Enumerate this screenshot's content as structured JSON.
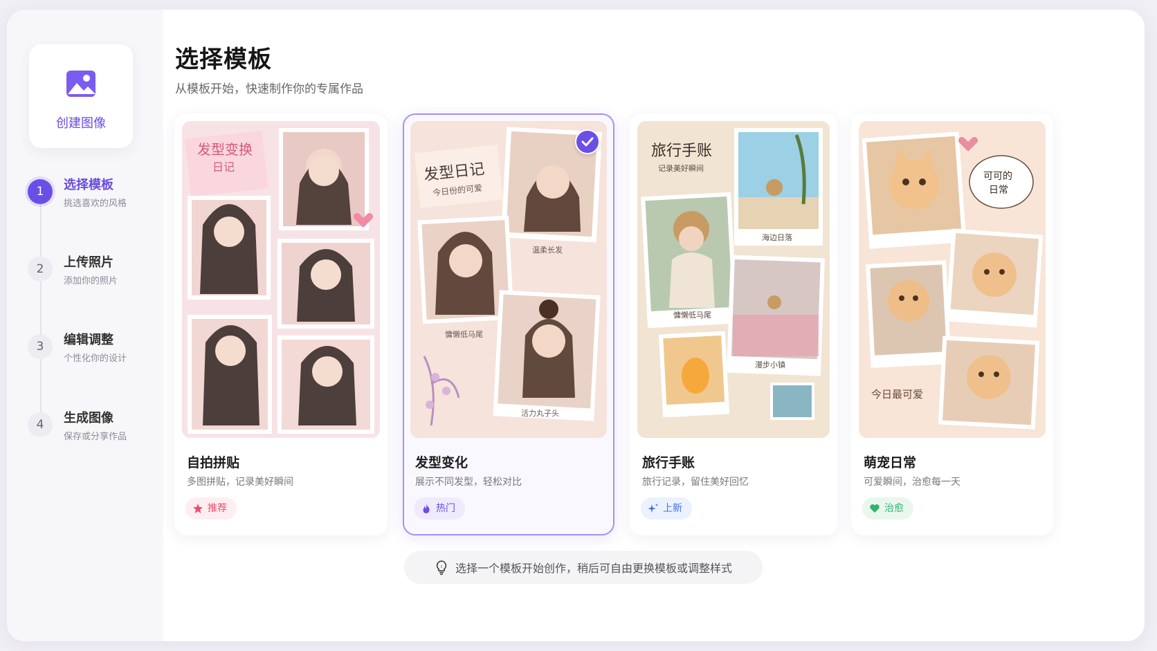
{
  "sidebar": {
    "app_label": "创建图像",
    "steps": [
      {
        "num": "1",
        "label": "选择模板",
        "desc": "挑选喜欢的风格",
        "active": true
      },
      {
        "num": "2",
        "label": "上传照片",
        "desc": "添加你的照片",
        "active": false
      },
      {
        "num": "3",
        "label": "编辑调整",
        "desc": "个性化你的设计",
        "active": false
      },
      {
        "num": "4",
        "label": "生成图像",
        "desc": "保存或分享作品",
        "active": false
      }
    ]
  },
  "main": {
    "title": "选择模板",
    "subtitle": "从模板开始，快速制作你的专属作品",
    "templates": [
      {
        "title": "自拍拼贴",
        "desc": "多图拼贴，记录美好瞬间",
        "tag": "推荐",
        "tag_icon": "star-icon",
        "tag_color": "#ef4a6b",
        "selected": false,
        "thumb_text": [
          "发型变换",
          "日记"
        ]
      },
      {
        "title": "发型变化",
        "desc": "展示不同发型，轻松对比",
        "tag": "热门",
        "tag_icon": "flame-icon",
        "tag_color": "#6b4ee6",
        "selected": true,
        "thumb_text": [
          "发型日记",
          "今日份的可爱",
          "温柔长发",
          "慵懒低马尾",
          "活力丸子头"
        ]
      },
      {
        "title": "旅行手账",
        "desc": "旅行记录，留住美好回忆",
        "tag": "上新",
        "tag_icon": "sparkle-icon",
        "tag_color": "#3e6fe0",
        "selected": false,
        "thumb_text": [
          "旅行手账",
          "记录美好瞬间",
          "海边日落",
          "慵懒低马尾",
          "漫步小镇"
        ]
      },
      {
        "title": "萌宠日常",
        "desc": "可爱瞬间，治愈每一天",
        "tag": "治愈",
        "tag_icon": "heart-icon",
        "tag_color": "#2fb36b",
        "selected": false,
        "thumb_text": [
          "可可的",
          "日常",
          "今日最可爱"
        ]
      }
    ],
    "hint": "选择一个模板开始创作，稍后可自由更换模板或调整样式"
  }
}
